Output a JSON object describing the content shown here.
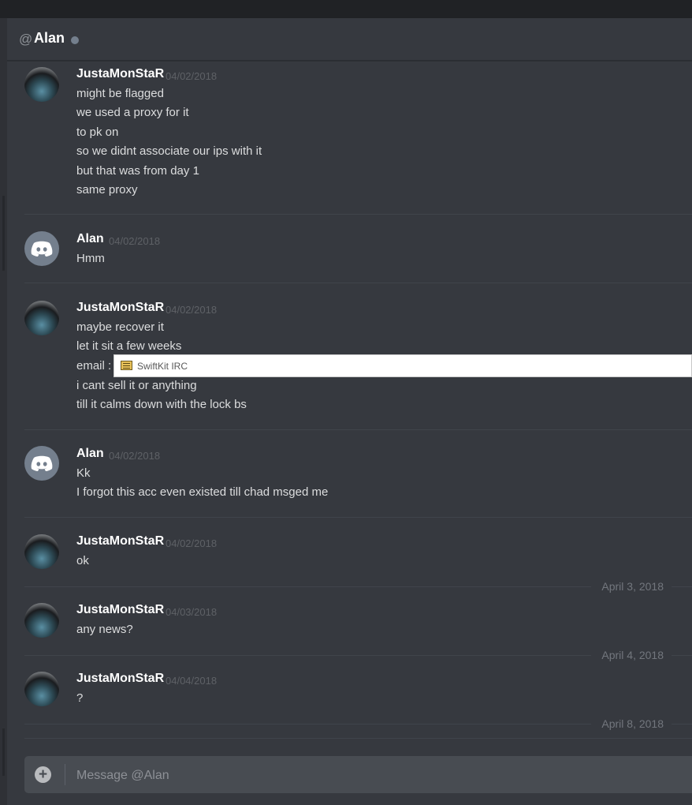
{
  "channel": {
    "at_symbol": "@",
    "name": "Alan",
    "status_color": "#747f8d"
  },
  "messages": [
    {
      "author": "JustaMonStaR",
      "timestamp": "04/02/2018",
      "lines": [
        "might be flagged",
        "we used a proxy for it",
        "to pk on",
        "so we didnt associate our ips with it",
        "but that was from day 1",
        "same proxy"
      ]
    },
    {
      "author": "Alan",
      "timestamp": "04/02/2018",
      "lines": [
        "Hmm"
      ]
    },
    {
      "author": "JustaMonStaR",
      "timestamp": "04/02/2018",
      "lines": [
        "maybe recover it",
        "let it sit a few weeks",
        "email :",
        "i cant sell it or anything",
        "till it calms down with the lock bs"
      ]
    },
    {
      "author": "Alan",
      "timestamp": "04/02/2018",
      "lines": [
        "Kk",
        "I forgot this acc even existed till chad msged me"
      ]
    },
    {
      "author": "JustaMonStaR",
      "timestamp": "04/02/2018",
      "lines": [
        "ok"
      ]
    },
    {
      "author": "JustaMonStaR",
      "timestamp": "04/03/2018",
      "lines": [
        "any news?"
      ]
    },
    {
      "author": "JustaMonStaR",
      "timestamp": "04/04/2018",
      "lines": [
        "?"
      ]
    }
  ],
  "date_dividers": [
    "April 3, 2018",
    "April 4, 2018",
    "April 8, 2018"
  ],
  "tooltip": {
    "label": "SwiftKit IRC",
    "icon": "swiftkit-app-icon"
  },
  "composer": {
    "placeholder": "Message @Alan",
    "value": ""
  },
  "colors": {
    "background": "#36393f",
    "author": "#ffffff",
    "text": "#dcddde",
    "timestamp": "#5e6166"
  }
}
